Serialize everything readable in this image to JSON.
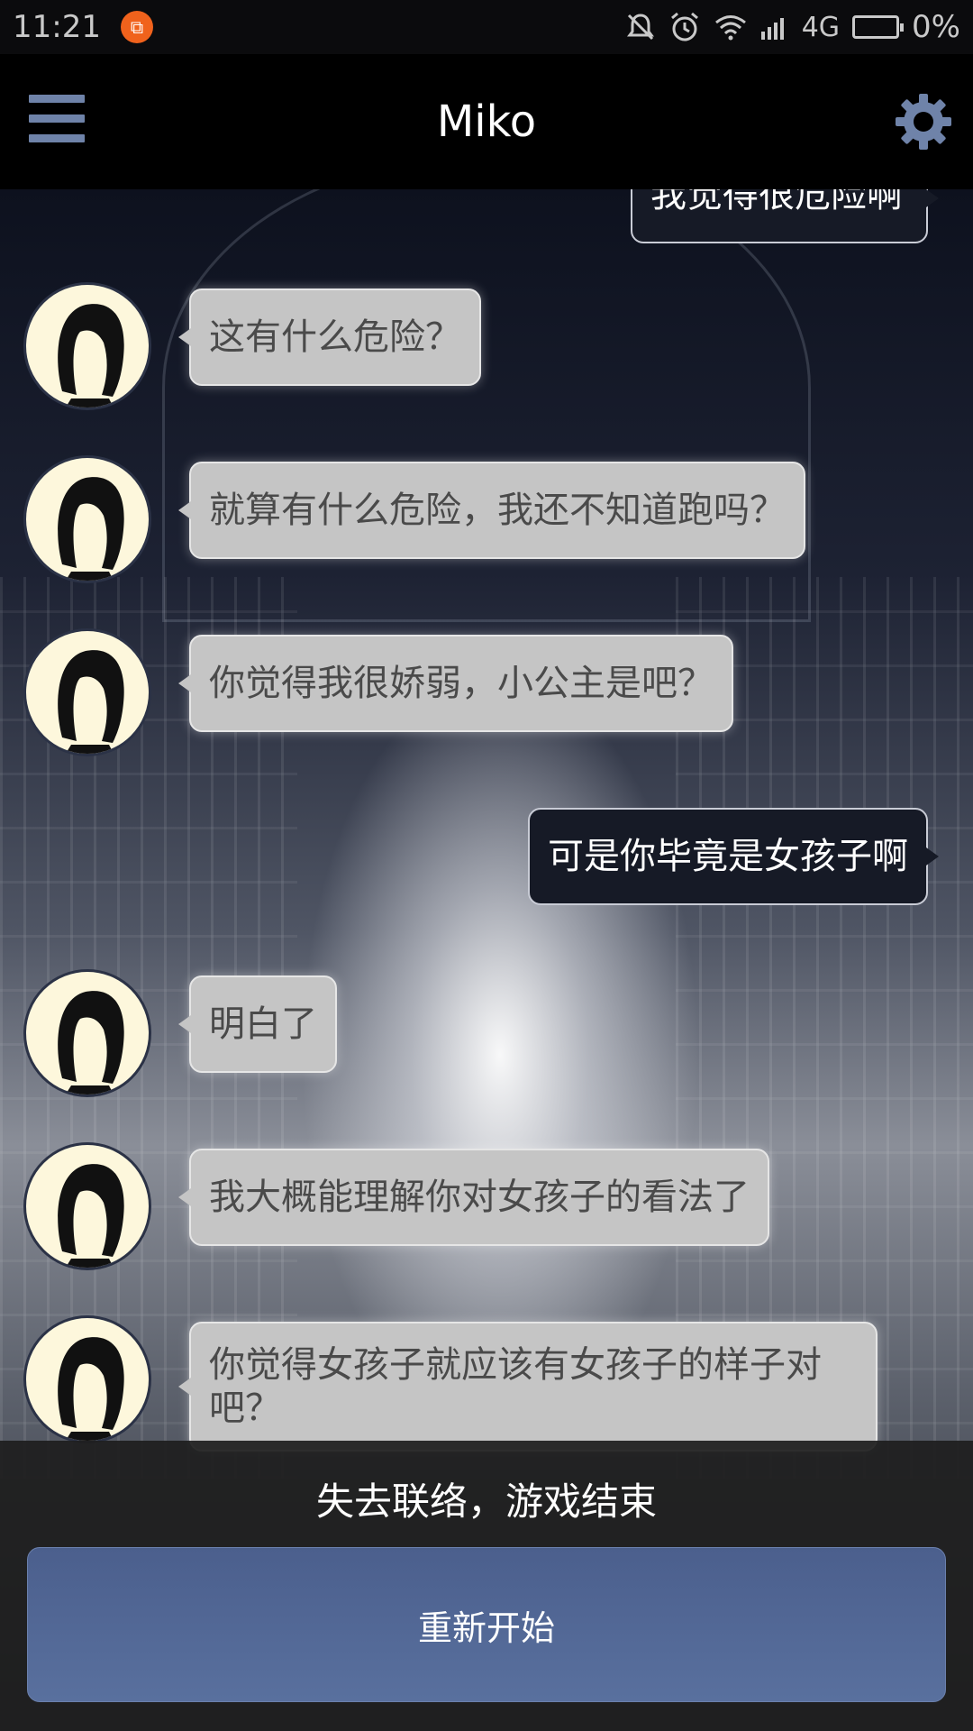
{
  "status_bar": {
    "time": "11:21",
    "network": "4G",
    "battery": "0%",
    "icons": [
      "app-badge-icon",
      "bell-off-icon",
      "alarm-icon",
      "wifi-icon",
      "signal-icon",
      "battery-icon"
    ]
  },
  "header": {
    "title": "Miko",
    "menu_icon": "hamburger-menu-icon",
    "settings_icon": "gear-icon"
  },
  "messages": [
    {
      "from": "me",
      "text": "我觉得很危险啊"
    },
    {
      "from": "miko",
      "text": "这有什么危险？"
    },
    {
      "from": "miko",
      "text": "就算有什么危险，我还不知道跑吗？"
    },
    {
      "from": "miko",
      "text": "你觉得我很娇弱，小公主是吧？"
    },
    {
      "from": "me",
      "text": "可是你毕竟是女孩子啊"
    },
    {
      "from": "miko",
      "text": "明白了"
    },
    {
      "from": "miko",
      "text": "我大概能理解你对女孩子的看法了"
    },
    {
      "from": "miko",
      "text": "你觉得女孩子就应该有女孩子的样子对吧？"
    }
  ],
  "game_over": {
    "text": "失去联络，游戏结束",
    "restart_label": "重新开始"
  },
  "colors": {
    "accent": "#6f83a9",
    "button": "#56699a",
    "bubble_in": "#c5c5c5",
    "bubble_out": "#161a26"
  }
}
